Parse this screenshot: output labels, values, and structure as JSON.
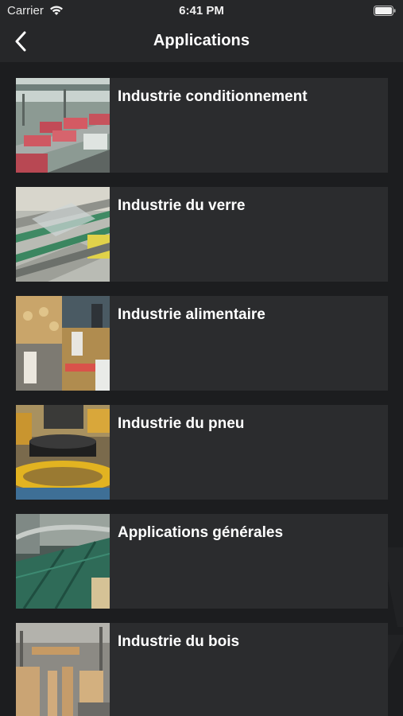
{
  "status_bar": {
    "carrier": "Carrier",
    "time": "6:41 PM"
  },
  "nav": {
    "title": "Applications",
    "back_icon": "chevron-left-icon"
  },
  "items": [
    {
      "title": "Industrie conditionnement",
      "thumb": "packaging-conveyor-photo"
    },
    {
      "title": "Industrie du verre",
      "thumb": "glass-conveyor-photo"
    },
    {
      "title": "Industrie alimentaire",
      "thumb": "food-processing-photo"
    },
    {
      "title": "Industrie du pneu",
      "thumb": "tire-handling-photo"
    },
    {
      "title": "Applications générales",
      "thumb": "general-belt-photo"
    },
    {
      "title": "Industrie du bois",
      "thumb": "wood-industry-photo"
    }
  ],
  "colors": {
    "background": "#1c1d1f",
    "bar": "#262729",
    "card": "#2b2c2e",
    "text": "#ffffff"
  }
}
